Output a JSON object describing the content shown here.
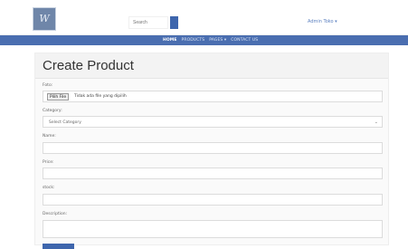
{
  "header": {
    "logo_text": "W",
    "search_placeholder": "Search",
    "admin_label": "Admin Toko ▾"
  },
  "nav": {
    "items": [
      "HOME",
      "PRODUCTS",
      "PAGES ▾",
      "CONTACT US"
    ]
  },
  "form": {
    "title": "Create Product",
    "photo_label": "Foto:",
    "file_button": "Pilih File",
    "file_status": "Tidak ada file yang dipilih",
    "category_label": "Category:",
    "category_selected": "Select Category",
    "name_label": "Name:",
    "price_label": "Price:",
    "stock_label": "stock:",
    "description_label": "Description:"
  },
  "colors": {
    "brand_blue": "#4a6eb0",
    "button_blue": "#3e66ad"
  }
}
